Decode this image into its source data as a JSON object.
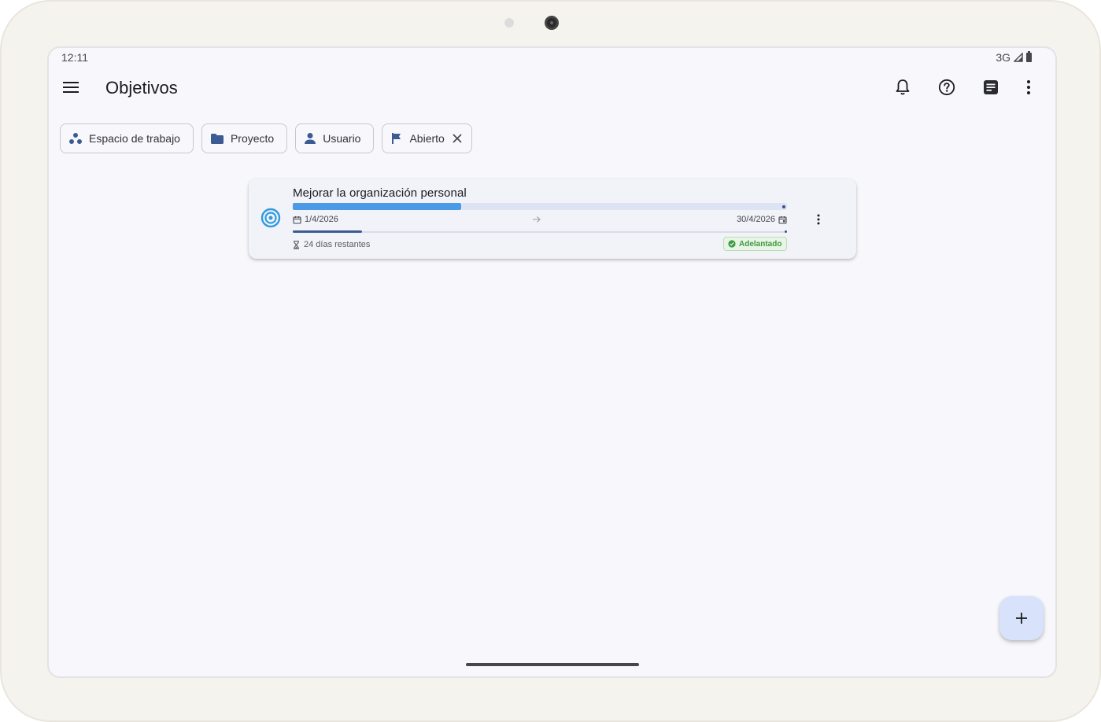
{
  "status_bar": {
    "time": "12:11",
    "network": "3G"
  },
  "app_bar": {
    "title": "Objetivos",
    "actions": [
      "notifications-icon",
      "help-icon",
      "notes-icon",
      "more-vert-icon"
    ]
  },
  "filters": [
    {
      "label": "Espacio de trabajo",
      "icon": "workspace-icon"
    },
    {
      "label": "Proyecto",
      "icon": "folder-icon"
    },
    {
      "label": "Usuario",
      "icon": "person-icon"
    },
    {
      "label": "Abierto",
      "icon": "flag-icon",
      "removable": true
    }
  ],
  "goals": [
    {
      "title": "Mejorar la organización personal",
      "progress": 0.34,
      "start_date": "1/4/2026",
      "end_date": "30/4/2026",
      "time_elapsed": 0.14,
      "remaining": "24 días restantes",
      "status": "Adelantado"
    }
  ],
  "colors": {
    "accent": "#4a9ae6",
    "primary": "#3c5a93",
    "success": "#3d9a40",
    "fab_bg": "#d8e2fa"
  }
}
